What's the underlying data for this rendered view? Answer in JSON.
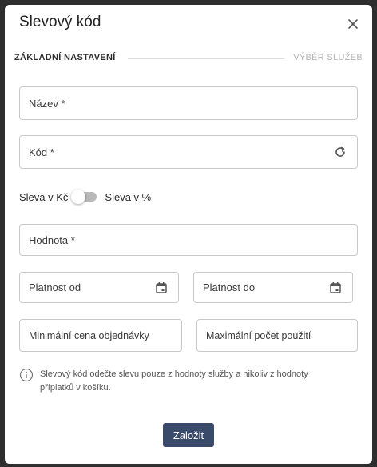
{
  "dialog": {
    "title": "Slevový kód",
    "close_icon": "close-icon"
  },
  "steps": {
    "active": "ZÁKLADNÍ NASTAVENÍ",
    "next": "VÝBĚR SLUŽEB"
  },
  "fields": {
    "name": "Název *",
    "code": "Kód *",
    "value": "Hodnota *",
    "valid_from": "Platnost od",
    "valid_to": "Platnost do",
    "min_price": "Minimální cena objednávky",
    "max_uses": "Maximální počet použití"
  },
  "discount_toggle": {
    "left_label": "Sleva v Kč",
    "right_label": "Sleva v %",
    "checked": false
  },
  "info_text": "Slevový kód odečte slevu pouze z hodnoty služby a nikoliv z hodnoty příplatků v košíku.",
  "submit_label": "Založit",
  "colors": {
    "primary_button": "#3a4a6b",
    "border": "#c9c9c9",
    "backdrop": "#2e2e2e"
  },
  "icons": [
    "close-icon",
    "refresh-icon",
    "calendar-icon",
    "info-icon"
  ]
}
